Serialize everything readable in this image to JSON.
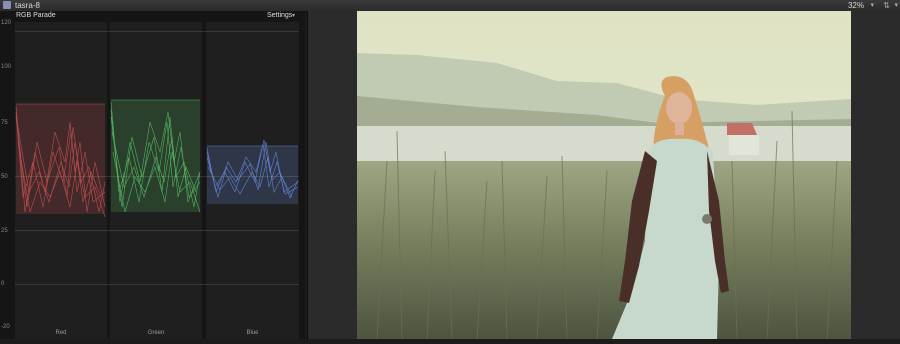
{
  "toolbar": {
    "clip_name": "tasra-8",
    "zoom": "32%",
    "zoom_arrow": "▾",
    "view_icon": "⇅",
    "view_arrow": "▾",
    "clip_icon": "clip-icon"
  },
  "scope": {
    "title": "RGB Parade",
    "settings_label": "Settings",
    "settings_arrow": "▾",
    "y_ticks": [
      "120",
      "100",
      "75",
      "50",
      "25",
      "0",
      "-20"
    ],
    "channels": [
      "Red",
      "Green",
      "Blue"
    ],
    "colors": {
      "red": "#e85a5a",
      "green": "#5fd870",
      "blue": "#6f95f0"
    }
  },
  "viewer": {
    "image_description": "woman-in-field-photo"
  }
}
